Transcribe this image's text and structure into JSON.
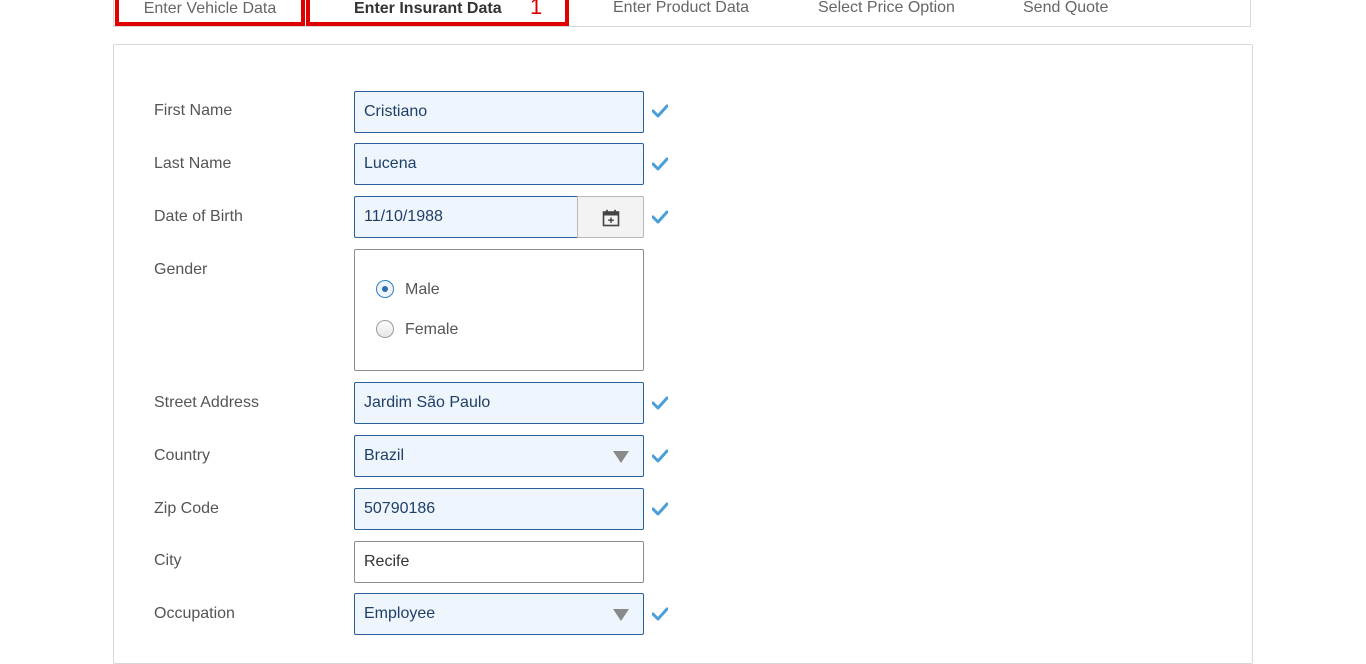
{
  "tabs": [
    {
      "label": "Enter Vehicle Data"
    },
    {
      "label": "Enter Insurant Data",
      "badge": "1"
    },
    {
      "label": "Enter Product Data"
    },
    {
      "label": "Select Price Option"
    },
    {
      "label": "Send Quote"
    }
  ],
  "form": {
    "first_name": {
      "label": "First Name",
      "value": "Cristiano"
    },
    "last_name": {
      "label": "Last Name",
      "value": "Lucena"
    },
    "date_of_birth": {
      "label": "Date of Birth",
      "value": "11/10/1988"
    },
    "gender": {
      "label": "Gender",
      "options": [
        "Male",
        "Female"
      ],
      "selected": "Male"
    },
    "street_address": {
      "label": "Street Address",
      "value": "Jardim São Paulo"
    },
    "country": {
      "label": "Country",
      "value": "Brazil"
    },
    "zip_code": {
      "label": "Zip Code",
      "value": "50790186"
    },
    "city": {
      "label": "City",
      "value": "Recife"
    },
    "occupation": {
      "label": "Occupation",
      "value": "Employee"
    }
  },
  "icons": {
    "valid": "checkmark-icon",
    "calendar": "calendar-icon",
    "dropdown": "dropdown-arrow-icon"
  },
  "colors": {
    "highlight": "#e00000",
    "valid_check": "#4a9fd8",
    "field_border": "#2a5f9e",
    "field_bg": "#eef5fd"
  }
}
